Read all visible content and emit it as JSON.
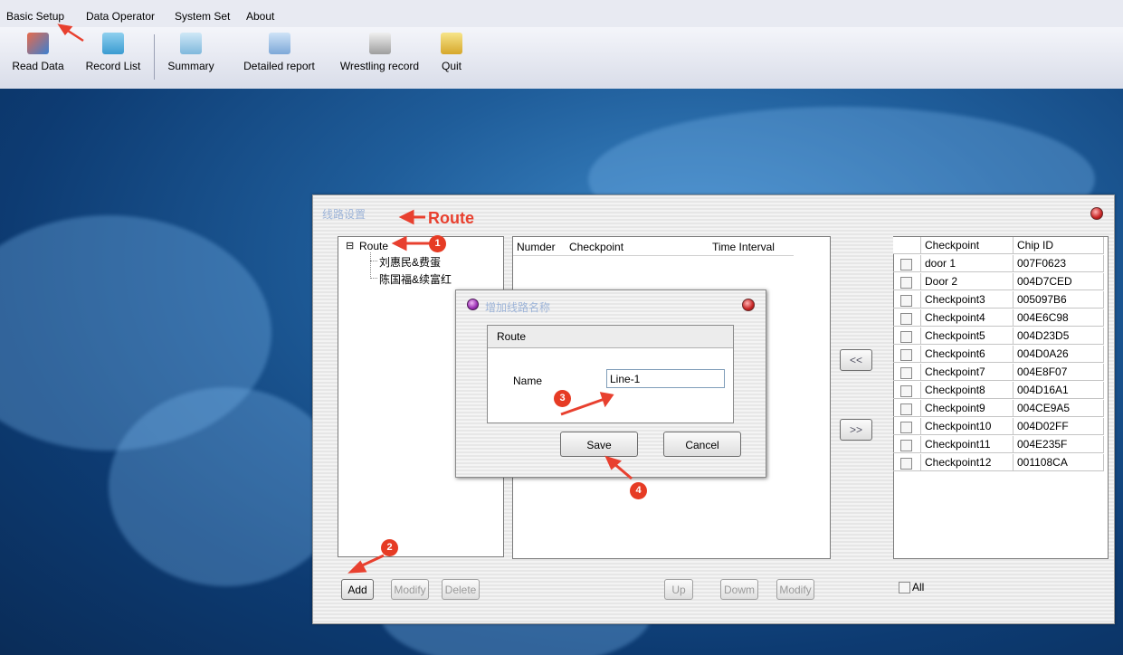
{
  "menu": [
    "Basic Setup",
    "Data Operator",
    "System Set",
    "About"
  ],
  "toolbar": [
    "Read Data",
    "Record List",
    "Summary",
    "Detailed report",
    "Wrestling record",
    "Quit"
  ],
  "main_window": {
    "title": "线路设置",
    "annotation": "Route",
    "tree": {
      "root": "Route",
      "children": [
        "刘惠民&费蛋",
        "陈国福&续富红"
      ]
    },
    "route_table_headers": [
      "Numder",
      "Checkpoint",
      "Time Interval"
    ],
    "left_buttons": [
      "Add",
      "Modify",
      "Delete"
    ],
    "middle_buttons": [
      "Up",
      "Dowm",
      "Modify"
    ],
    "move_left": "<<",
    "move_right": ">>",
    "checkpoint_headers": [
      "Checkpoint",
      "Chip ID"
    ],
    "checkpoints": [
      {
        "name": "door 1",
        "chip": "007F0623"
      },
      {
        "name": "Door 2",
        "chip": "004D7CED"
      },
      {
        "name": "Checkpoint3",
        "chip": "005097B6"
      },
      {
        "name": "Checkpoint4",
        "chip": "004E6C98"
      },
      {
        "name": "Checkpoint5",
        "chip": "004D23D5"
      },
      {
        "name": "Checkpoint6",
        "chip": "004D0A26"
      },
      {
        "name": "Checkpoint7",
        "chip": "004E8F07"
      },
      {
        "name": "Checkpoint8",
        "chip": "004D16A1"
      },
      {
        "name": "Checkpoint9",
        "chip": "004CE9A5"
      },
      {
        "name": "Checkpoint10",
        "chip": "004D02FF"
      },
      {
        "name": "Checkpoint11",
        "chip": "004E235F"
      },
      {
        "name": "Checkpoint12",
        "chip": "001108CA"
      }
    ],
    "all_label": "All"
  },
  "dialog": {
    "title": "增加线路名称",
    "group_label": "Route",
    "name_label": "Name",
    "name_value": "Line-1",
    "save": "Save",
    "cancel": "Cancel"
  },
  "badges": [
    "1",
    "2",
    "3",
    "4"
  ],
  "colors": {
    "annotation": "#e8402f",
    "desktop": "#1f5d9a"
  }
}
